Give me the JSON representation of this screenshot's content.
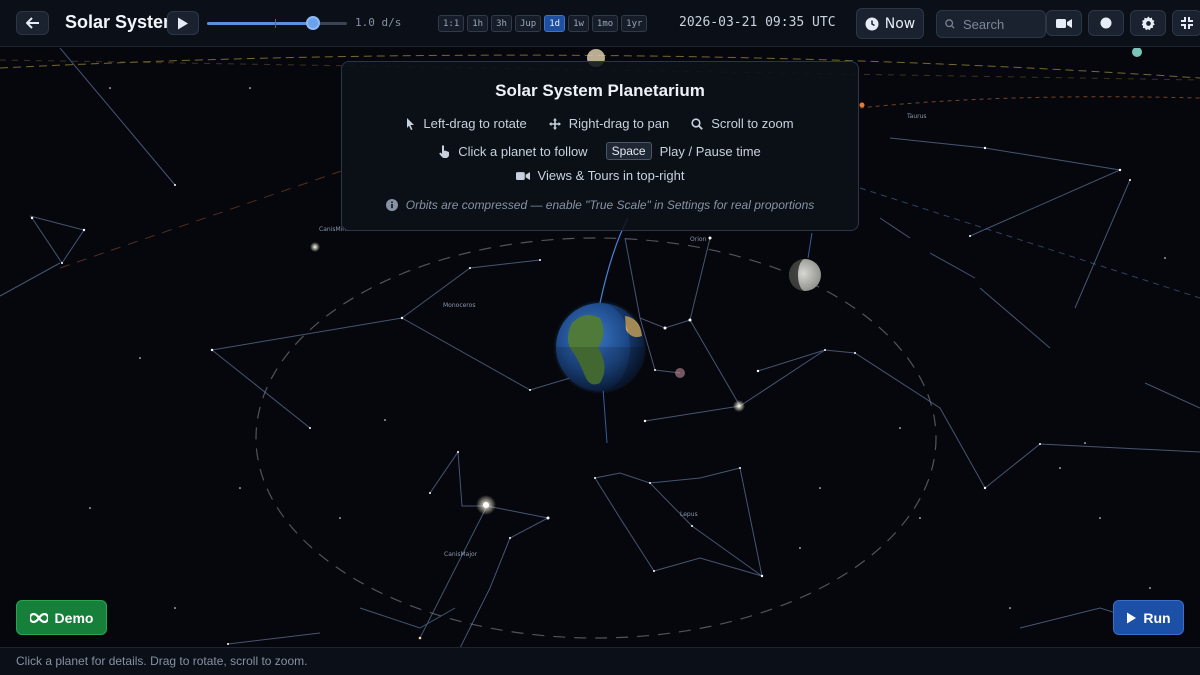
{
  "app": {
    "title": "Solar System",
    "speed_value": "1.0 d/s",
    "speed_slider_fraction": 0.76,
    "datetime": "2026-03-21 09:35 UTC"
  },
  "time_steps": [
    {
      "label": "1:1",
      "active": false
    },
    {
      "label": "1h",
      "active": false
    },
    {
      "label": "3h",
      "active": false
    },
    {
      "label": "Jup",
      "active": false
    },
    {
      "label": "1d",
      "active": true
    },
    {
      "label": "1w",
      "active": false
    },
    {
      "label": "1mo",
      "active": false
    },
    {
      "label": "1yr",
      "active": false
    }
  ],
  "toolbar": {
    "now_label": "Now",
    "search_placeholder": "Search",
    "icons": [
      "back-arrow-icon",
      "play-icon",
      "clock-icon",
      "search-icon",
      "video-camera-icon",
      "record-circle-icon",
      "gear-icon",
      "compress-icon"
    ]
  },
  "overlay": {
    "title": "Solar System Planetarium",
    "hints": {
      "rotate": "Left-drag to rotate",
      "pan": "Right-drag to pan",
      "zoom": "Scroll to zoom",
      "follow": "Click a planet to follow",
      "key": "Space",
      "play_pause": "Play / Pause time",
      "views": "Views & Tours in top-right"
    },
    "note": "Orbits are compressed — enable \"True Scale\" in Settings for real proportions"
  },
  "sky_labels": {
    "canis_minor": "CanisMin…",
    "monoceros": "Monoceros",
    "orion": "Orion",
    "lepus": "Lepus",
    "canis_major": "CanisMajor",
    "taurus": "Taurus"
  },
  "buttons": {
    "demo": "Demo",
    "run": "Run"
  },
  "status_text": "Click a planet for details. Drag to rotate, scroll to zoom.",
  "colors": {
    "accent": "#1f4fa0",
    "demo": "#16803a",
    "run": "#1c4fa6",
    "background": "#05070c"
  }
}
